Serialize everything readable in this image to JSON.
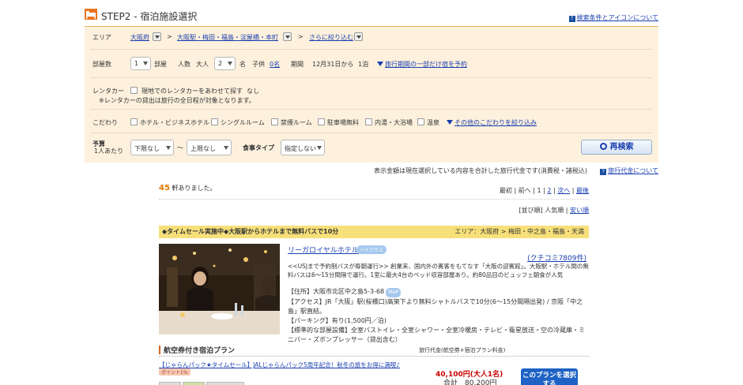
{
  "header": {
    "title": "STEP2 - 宿泊施設選択",
    "help_link": "検索条件とアイコンについて"
  },
  "search": {
    "area_label": "エリア",
    "area_pref": "大阪府",
    "area_city": "大阪駅・梅田・福島・淀屋橋・本町",
    "area_more": "さらに絞り込む",
    "rooms_label": "部屋数",
    "rooms_value": "1",
    "rooms_unit": "部屋",
    "people_label": "人数",
    "adults_label": "大人",
    "adults_value": "2",
    "adults_unit": "名",
    "children_label": "子供",
    "children_value": "0名",
    "period_label": "期間",
    "period_value": "12月31日から",
    "nights_value": "1泊",
    "period_link": "旅行期間の一部だけ宿を予約",
    "rental_label": "レンタカー",
    "rental_option": "現地でのレンタカーをあわせて探す",
    "rental_value": "なし",
    "rental_note": "※レンタカーの貸出は旅行の全日程が対象となります。",
    "pref_label": "こだわり",
    "pref_options": [
      "ホテル・ビジネスホテル",
      "シングルルーム",
      "禁煙ルーム",
      "駐車場無料",
      "内湯・大浴場",
      "温泉"
    ],
    "pref_more": "その他のこだわりを絞り込み",
    "budget_label": "予算",
    "budget_sub": "1人あたり",
    "budget_min": "下限なし",
    "budget_tilde": "〜",
    "budget_max": "上限なし",
    "meal_label": "食事タイプ",
    "meal_value": "指定しない",
    "search_button": "再検索"
  },
  "notice": {
    "text": "表示金額は現在選択している内容を合計した旅行代金です(消費税・諸税込)",
    "link": "旅行代金について"
  },
  "results": {
    "count": "45",
    "count_suffix": "軒ありました。",
    "pager": {
      "first": "最初",
      "prev": "前へ",
      "page1": "1",
      "page2": "2",
      "next": "次へ",
      "last": "最後"
    },
    "sort": {
      "label": "[並び順]",
      "popular": "人気順",
      "cheap": "安い順"
    }
  },
  "hotel": {
    "ribbon": "◆タイムセール実施中◆大阪駅からホテルまで無料バスで10分",
    "area": "エリア：大阪府 > 梅田・中之島・福島・天満",
    "name": "リーガロイヤルホテル",
    "badge": "ハイクラス",
    "reviews": "(クチコミ7809件)",
    "desc": "<<USJまで予約制バスが毎朝運行>> 創業来、国内外の賓客をもてなす「大阪の迎賓館」。大阪駅・ホテル間の無料バスは6～15分間隔で運行。1室に最大4台のベッド収容部屋あり。約80品目のビュッフェ朝食が人気",
    "addr": "【住所】大阪市北区中之島5-3-68",
    "map": "MAP",
    "access": "【アクセス】JR「大阪」駅(桜橋口)高架下より無料シャトルバスで10分(6～15分間隔出発) / 京阪「中之島」駅直結。",
    "parking": "【パーキング】有り(1,500円／泊)",
    "facilities": "【標準的な部屋設備】全室バストイレ・全室シャワー・全室冷暖房・テレビ・衛星放送・空の冷蔵庫・ミニバー・ズボンプレッサー（貸出含む）"
  },
  "plans": {
    "title": "航空券付き宿泊プラン",
    "col": "旅行代金(航空券+宿泊プラン料金)",
    "plan_link": "【じゃらんパック★タイムセール】JALじゃらんパック5周年記念！秋冬の旅をお得に満喫♪",
    "point": "ポイント1%",
    "price": "40,100円(大人1名)",
    "total": "合計　80,200円",
    "button": "このプランを選択する"
  },
  "colors": {
    "accent": "#1a3fb0",
    "panel": "#fdf1dd",
    "ribbon": "#f7e07a",
    "count": "#e07a00",
    "price": "#cc0000",
    "plan_button": "#1d62c4"
  }
}
